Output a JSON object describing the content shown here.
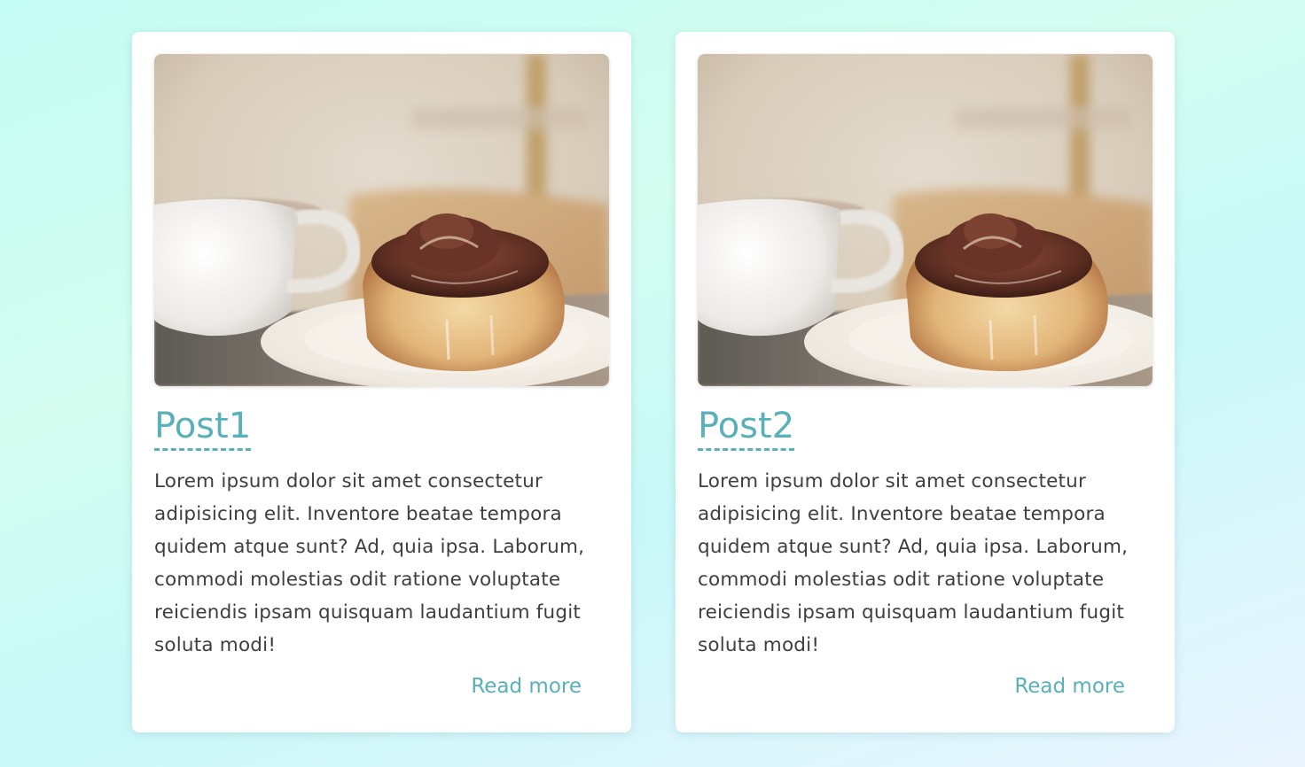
{
  "posts": [
    {
      "title": "Post1",
      "body": "Lorem ipsum dolor sit amet consectetur adipisicing elit. Inventore beatae tempora quidem atque sunt? Ad, quia ipsa. Laborum, commodi molestias odit ratione voluptate reiciendis ipsam quisquam laudantium fugit soluta modi!",
      "link_label": "Read more"
    },
    {
      "title": "Post2",
      "body": "Lorem ipsum dolor sit amet consectetur adipisicing elit. Inventore beatae tempora quidem atque sunt? Ad, quia ipsa. Laborum, commodi molestias odit ratione voluptate reiciendis ipsam quisquam laudantium fugit soluta modi!",
      "link_label": "Read more"
    }
  ],
  "colors": {
    "accent": "#5ab0b8",
    "text": "#3e3e3e",
    "card": "#ffffff"
  }
}
